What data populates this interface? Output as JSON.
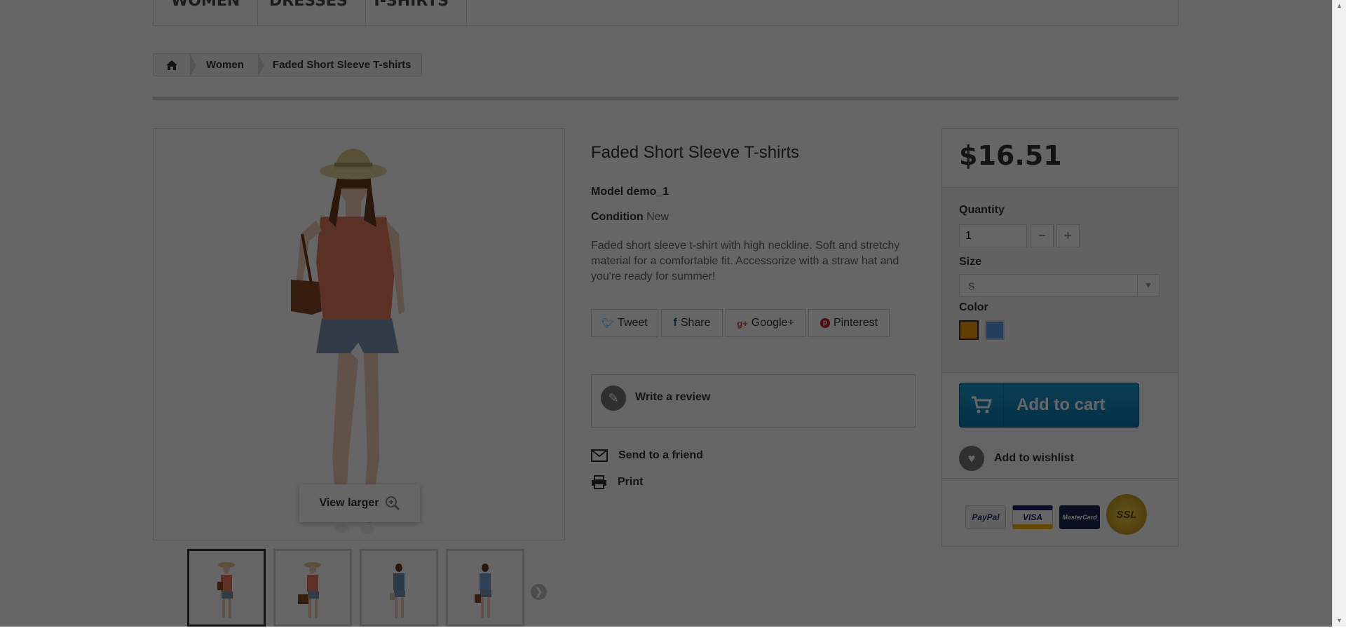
{
  "menu": {
    "items": [
      "WOMEN",
      "DRESSES",
      "T-SHIRTS"
    ]
  },
  "breadcrumb": {
    "home_icon": "home-icon",
    "items": [
      "Women",
      "Faded Short Sleeve T-shirts"
    ]
  },
  "image": {
    "view_larger_label": "View larger",
    "zoom_icon": "zoom-in-icon",
    "thumbnails": 4,
    "selected_thumbnail": 0
  },
  "product": {
    "title": "Faded Short Sleeve T-shirts",
    "model_label": "Model",
    "model_value": "demo_1",
    "condition_label": "Condition",
    "condition_value": "New",
    "description": "Faded short sleeve t-shirt with high neckline. Soft and stretchy material for a comfortable fit. Accessorize with a straw hat and you're ready for summer!"
  },
  "social": {
    "tweet": "Tweet",
    "share": "Share",
    "googleplus": "Google+",
    "pinterest": "Pinterest"
  },
  "actions": {
    "write_review": "Write a review",
    "send_friend": "Send to a friend",
    "print": "Print"
  },
  "buybox": {
    "price": "$16.51",
    "quantity_label": "Quantity",
    "quantity_value": "1",
    "size_label": "Size",
    "size_value": "S",
    "color_label": "Color",
    "colors": [
      "#F39C11",
      "#5D9CEC"
    ],
    "add_to_cart": "Add to cart",
    "add_to_wishlist": "Add to wishlist"
  },
  "payments": {
    "paypal": "PayPal",
    "visa": "VISA",
    "mastercard": "MasterCard",
    "ssl": "SSL"
  }
}
